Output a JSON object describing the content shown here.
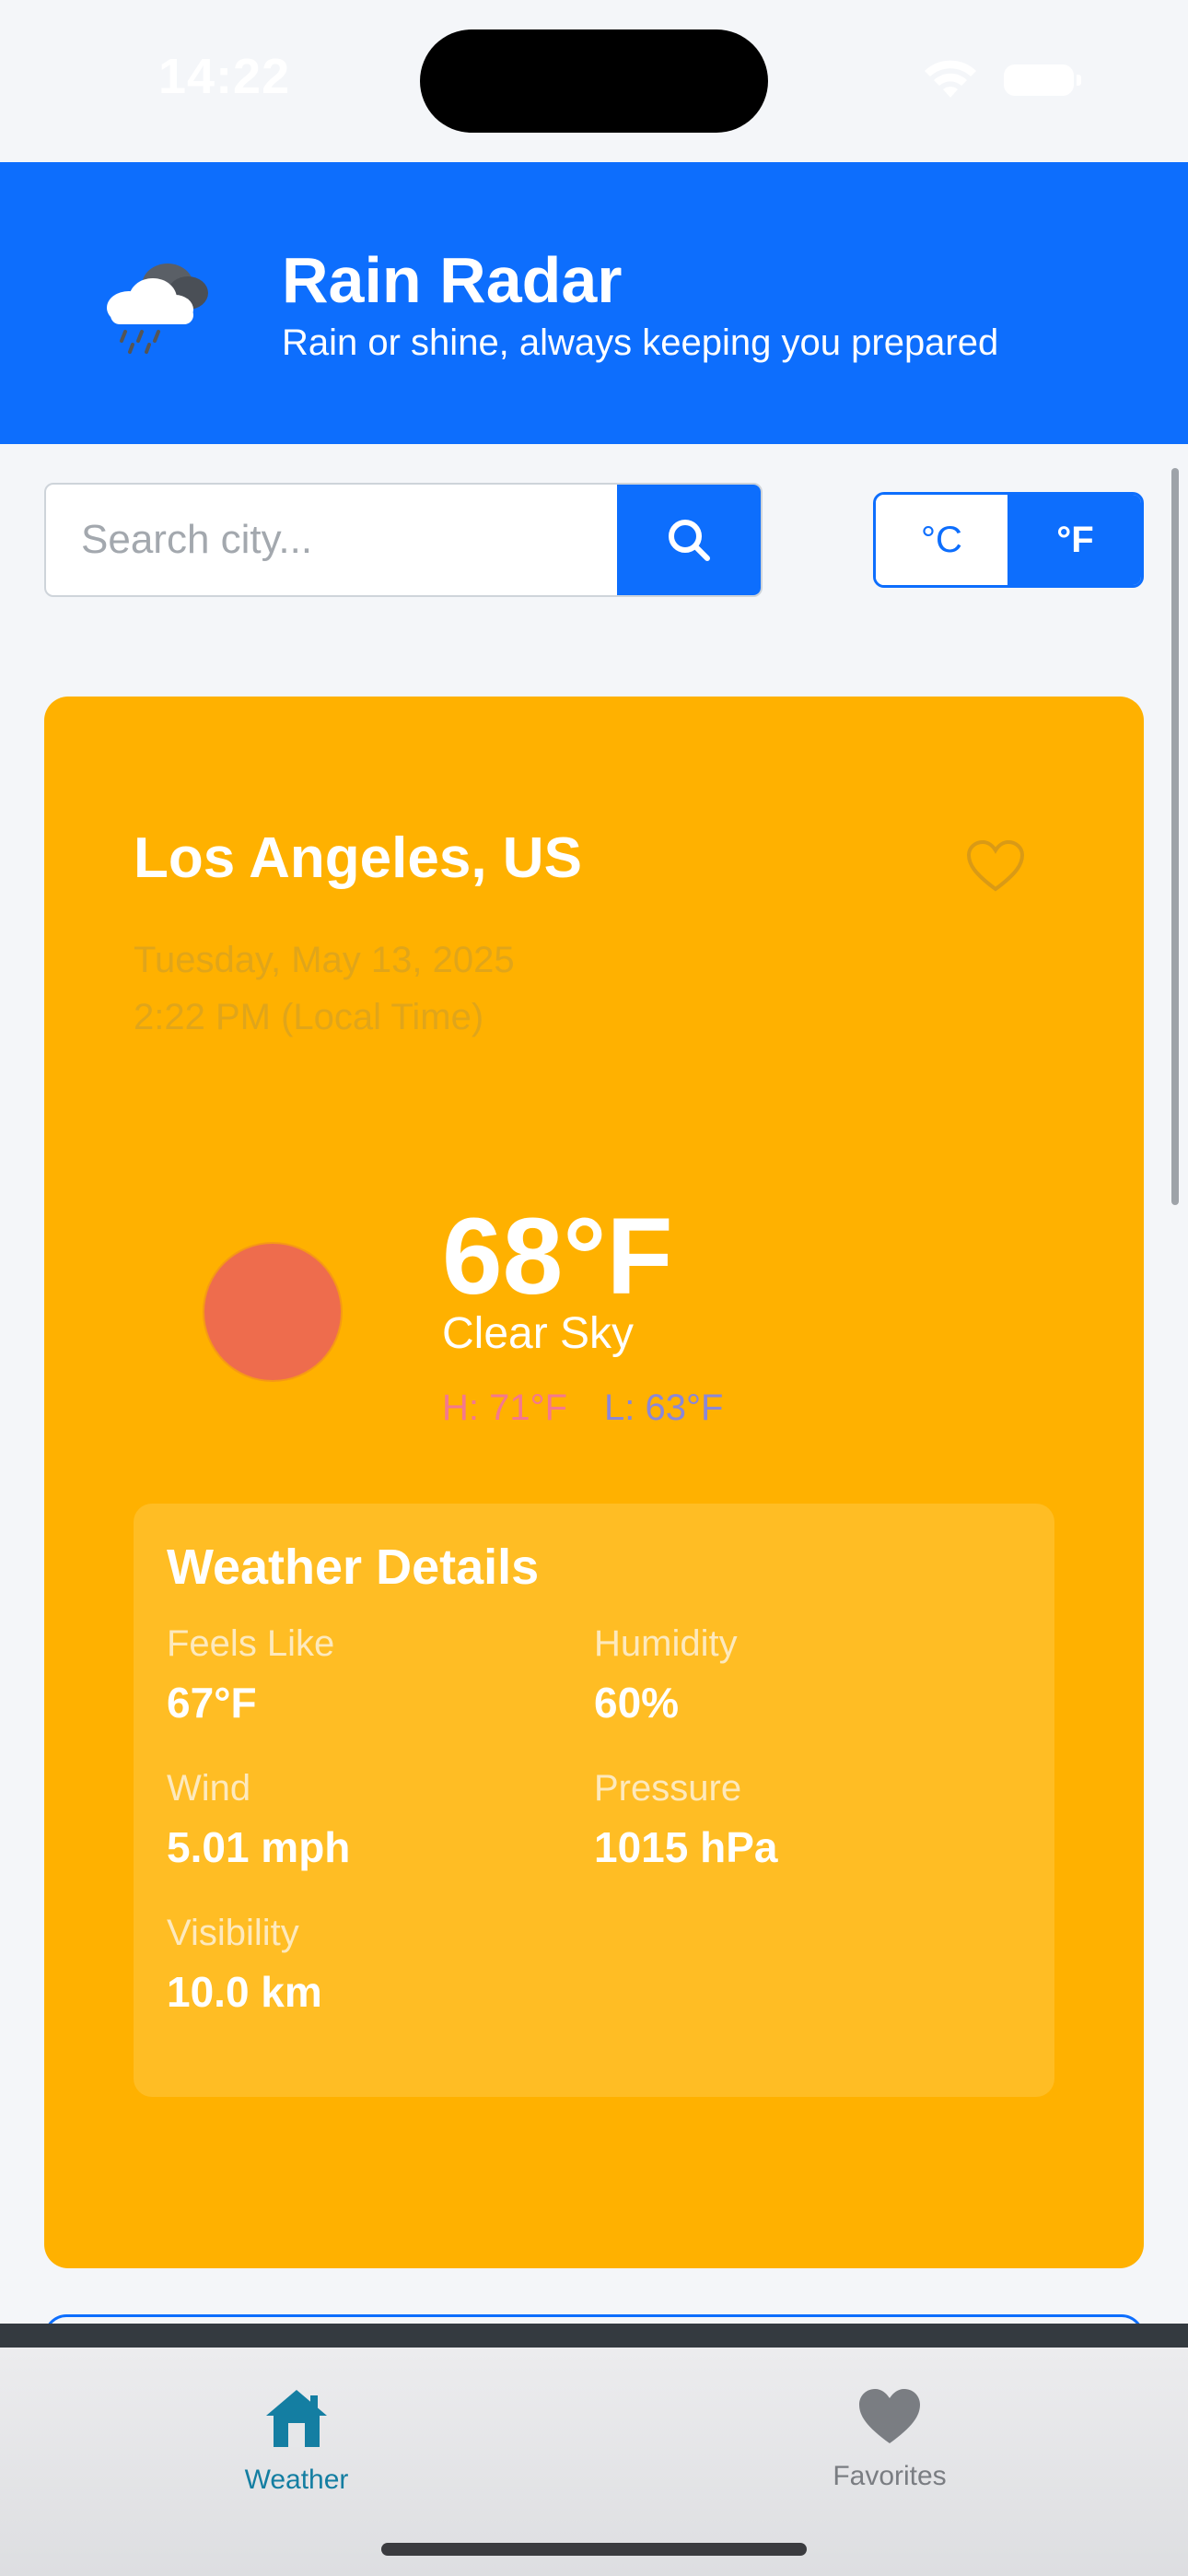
{
  "status_bar": {
    "time": "14:22"
  },
  "header": {
    "logo_icon": "rain-cloud-icon",
    "title": "Rain Radar",
    "subtitle": "Rain or shine, always keeping you prepared",
    "background": "#0d6efd"
  },
  "search": {
    "placeholder": "Search city...",
    "value": "",
    "button_icon": "search-icon"
  },
  "units": {
    "celsius_label": "°C",
    "fahrenheit_label": "°F",
    "selected": "°F"
  },
  "weather": {
    "location": "Los Angeles, US",
    "favorite_icon": "heart-outline-icon",
    "date": "Tuesday, May 13, 2025",
    "time": "2:22 PM (Local Time)",
    "condition_icon": "sun-icon",
    "temperature": "68°F",
    "condition": "Clear Sky",
    "high": "H: 71°F",
    "low": "L: 63°F",
    "card_color": "#ffb100",
    "details": {
      "title": "Weather Details",
      "feels_like_label": "Feels Like",
      "feels_like": "67°F",
      "humidity_label": "Humidity",
      "humidity": "60%",
      "wind_label": "Wind",
      "wind": "5.01 mph",
      "pressure_label": "Pressure",
      "pressure": "1015 hPa",
      "visibility_label": "Visibility",
      "visibility": "10.0 km"
    }
  },
  "tab_bar": {
    "tabs": [
      {
        "label": "Weather",
        "icon": "home-icon",
        "active": true
      },
      {
        "label": "Favorites",
        "icon": "heart-icon",
        "active": false
      }
    ]
  }
}
